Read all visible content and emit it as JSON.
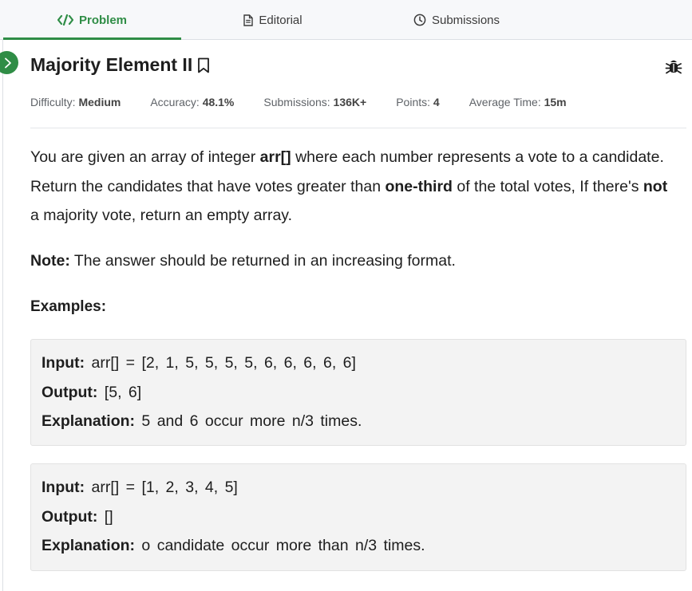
{
  "tabs": [
    {
      "label": "Problem",
      "icon": "code-icon",
      "active": true
    },
    {
      "label": "Editorial",
      "icon": "document-icon",
      "active": false
    },
    {
      "label": "Submissions",
      "icon": "clock-icon",
      "active": false
    }
  ],
  "colors": {
    "accent": "#2f8d46",
    "text": "#1e1e1e",
    "muted": "#5f6368",
    "example_bg": "#f3f3f3"
  },
  "problem": {
    "title": "Majority Element II",
    "meta": [
      {
        "label": "Difficulty:",
        "value": "Medium"
      },
      {
        "label": "Accuracy:",
        "value": "48.1%"
      },
      {
        "label": "Submissions:",
        "value": "136K+"
      },
      {
        "label": "Points:",
        "value": "4"
      },
      {
        "label": "Average Time:",
        "value": "15m"
      }
    ],
    "description": {
      "p1": "You are given an array of integer ",
      "b1": "arr[]",
      "p2": " where each number represents a vote to a candidate. Return the candidates that have votes greater than ",
      "b2": "one-third",
      "p3": " of the total votes, If there's ",
      "b3": "not",
      "p4": " a majority vote, return an empty array."
    },
    "note": {
      "label": "Note:",
      "text": " The answer should be returned in an increasing format."
    },
    "examples_heading": "Examples:",
    "examples": [
      {
        "input_label": "Input:",
        "input": " arr[] = [2, 1, 5, 5, 5, 5, 6, 6, 6, 6, 6]",
        "output_label": "Output:",
        "output": " [5, 6]",
        "explanation_label": "Explanation:",
        "explanation": " 5 and 6 occur more n/3 times."
      },
      {
        "input_label": "Input:",
        "input": " arr[] = [1, 2, 3, 4, 5]",
        "output_label": "Output:",
        "output": " []",
        "explanation_label": "Explanation:",
        "explanation": " o candidate occur more than n/3 times."
      }
    ]
  }
}
